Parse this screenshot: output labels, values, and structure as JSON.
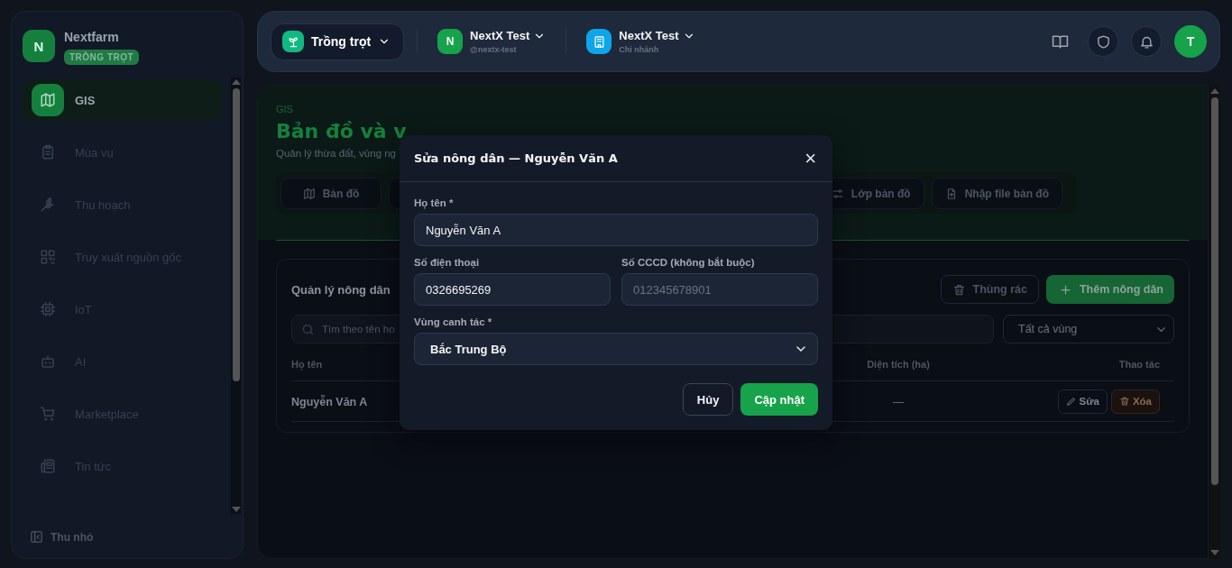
{
  "sidebar": {
    "logo": "N",
    "brand": "Nextfarm",
    "badge": "TRỒNG TRỌT",
    "items": [
      {
        "label": "GIS",
        "selected": true
      },
      {
        "label": "Mùa vụ",
        "selected": false
      },
      {
        "label": "Thu hoạch",
        "selected": false
      },
      {
        "label": "Truy xuất nguồn gốc",
        "selected": false
      },
      {
        "label": "IoT",
        "selected": false
      },
      {
        "label": "AI",
        "selected": false
      },
      {
        "label": "Marketplace",
        "selected": false
      },
      {
        "label": "Tin tức",
        "selected": false
      }
    ],
    "collapse": "Thu nhỏ"
  },
  "topbar": {
    "crop": "Trồng trọt",
    "org": {
      "avatar": "N",
      "name": "NextX Test",
      "handle": "@nextx-test"
    },
    "branch": {
      "name": "NextX Test",
      "sub": "Chi nhánh"
    },
    "user_avatar": "T"
  },
  "page": {
    "eyebrow": "GIS",
    "title": "Bản đồ và v",
    "subtitle": "Quản lý thừa đất, vùng ng",
    "tabs": [
      {
        "label": "Bản đồ"
      },
      {
        "label": "Lớp bản đồ"
      },
      {
        "label": "Nhập file bản đồ"
      }
    ]
  },
  "farmers": {
    "title": "Quản lý nông dân",
    "trash_button": "Thùng rác",
    "add_button": "Thêm nông dân",
    "search": {
      "placeholder": "Tìm theo tên ho"
    },
    "region_filter": "Tất cả vùng",
    "columns": [
      "Họ tên",
      "Diện tích (ha)",
      "Thao tác"
    ],
    "rows": [
      {
        "name": "Nguyễn Văn A",
        "area": "—",
        "edit": "Sửa",
        "delete": "Xóa"
      }
    ]
  },
  "dialog": {
    "title": "Sửa nông dân — Nguyễn Văn A",
    "close": "×",
    "fields": [
      {
        "label": "Họ tên *",
        "value": "Nguyễn Văn A",
        "kind": "text"
      },
      {
        "label": "Số điện thoại",
        "value": "0326695269",
        "kind": "text"
      },
      {
        "label": "Số CCCD (không bắt buộc)",
        "placeholder": "012345678901",
        "kind": "text"
      },
      {
        "label": "Vùng canh tác *",
        "value": "Bắc Trung Bộ",
        "kind": "select"
      }
    ],
    "cancel": "Hủy",
    "submit": "Cập nhật"
  }
}
